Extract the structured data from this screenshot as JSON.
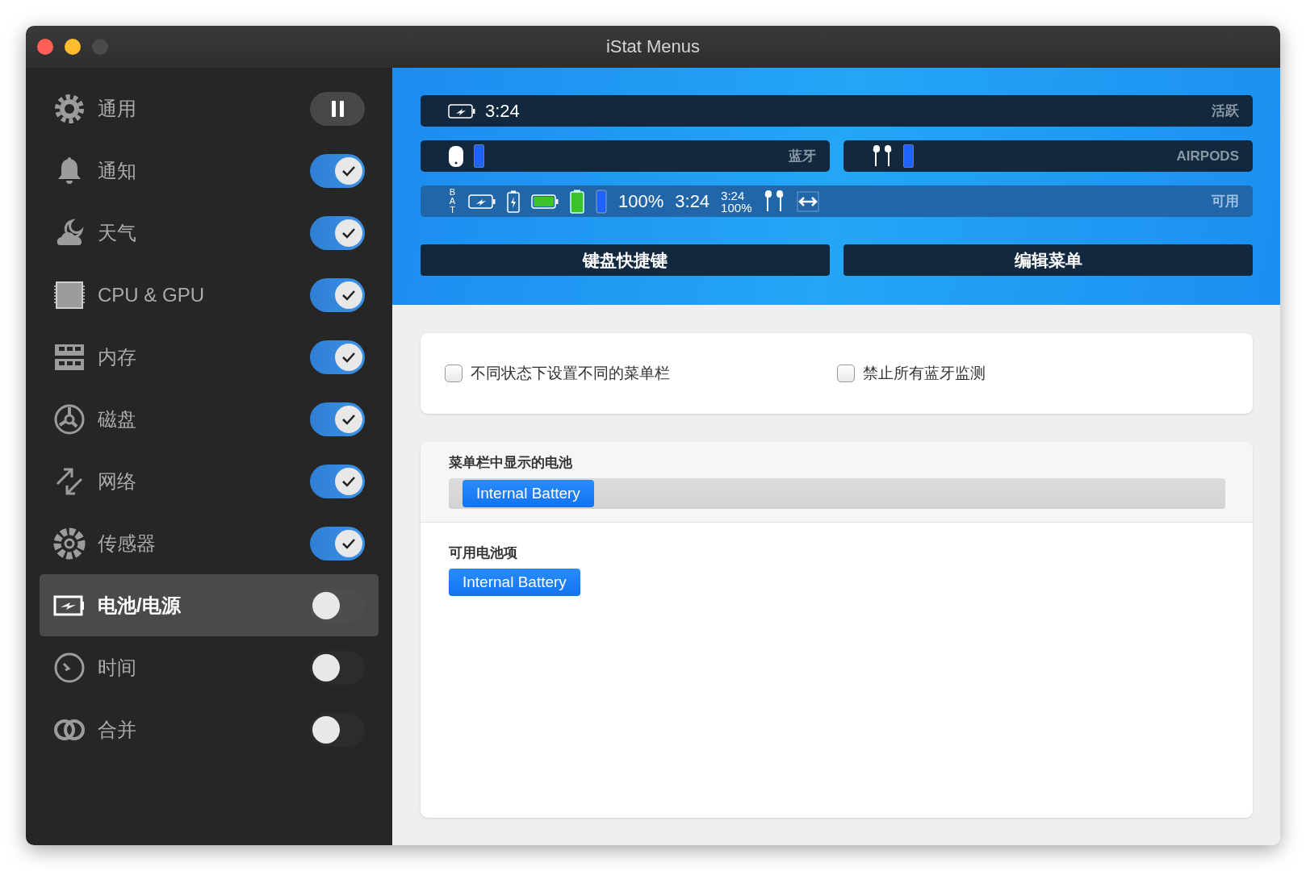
{
  "window": {
    "title": "iStat Menus"
  },
  "sidebar": {
    "items": [
      {
        "label": "通用",
        "kind": "pause",
        "selected": false
      },
      {
        "label": "通知",
        "kind": "toggle",
        "on": true,
        "selected": false
      },
      {
        "label": "天气",
        "kind": "toggle",
        "on": true,
        "selected": false
      },
      {
        "label": "CPU & GPU",
        "kind": "toggle",
        "on": true,
        "selected": false
      },
      {
        "label": "内存",
        "kind": "toggle",
        "on": true,
        "selected": false
      },
      {
        "label": "磁盘",
        "kind": "toggle",
        "on": true,
        "selected": false
      },
      {
        "label": "网络",
        "kind": "toggle",
        "on": true,
        "selected": false
      },
      {
        "label": "传感器",
        "kind": "toggle",
        "on": true,
        "selected": false
      },
      {
        "label": "电池/电源",
        "kind": "toggle",
        "on": false,
        "selected": true
      },
      {
        "label": "时间",
        "kind": "toggle",
        "on": false,
        "selected": false
      },
      {
        "label": "合并",
        "kind": "toggle",
        "on": false,
        "selected": false
      }
    ]
  },
  "preview": {
    "active": {
      "time": "3:24",
      "label": "活跃"
    },
    "devices": [
      {
        "label": "蓝牙",
        "level": 1
      },
      {
        "label": "AIRPODS",
        "level": 1
      }
    ],
    "available": {
      "bat": "BAT",
      "percent": "100%",
      "time": "3:24",
      "stacked_time": "3:24",
      "stacked_percent": "100%",
      "label": "可用"
    },
    "buttons": [
      "键盘快捷键",
      "编辑菜单"
    ]
  },
  "options": {
    "checkboxes": [
      {
        "label": "不同状态下设置不同的菜单栏",
        "checked": false
      },
      {
        "label": "禁止所有蓝牙监测",
        "checked": false
      }
    ]
  },
  "batteries": {
    "menubar_title": "菜单栏中显示的电池",
    "menubar_items": [
      "Internal Battery"
    ],
    "available_title": "可用电池项",
    "available_items": [
      "Internal Battery"
    ]
  }
}
